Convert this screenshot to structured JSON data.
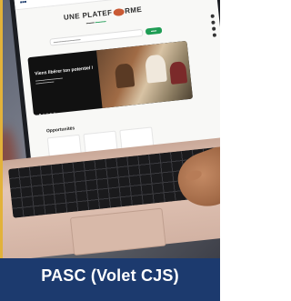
{
  "caption": "PASC (Volet CJS)",
  "colors": {
    "caption_bg": "#1c3a6e",
    "caption_text": "#ffffff",
    "left_border": "#e2b23a",
    "site_accent": "#1f9d55"
  },
  "screen": {
    "hero_title_left": "UNE PLATEF",
    "hero_title_right": "RME",
    "banner_title": "Viens libérer ton potentiel !",
    "opportunities_title": "Opportunités"
  }
}
